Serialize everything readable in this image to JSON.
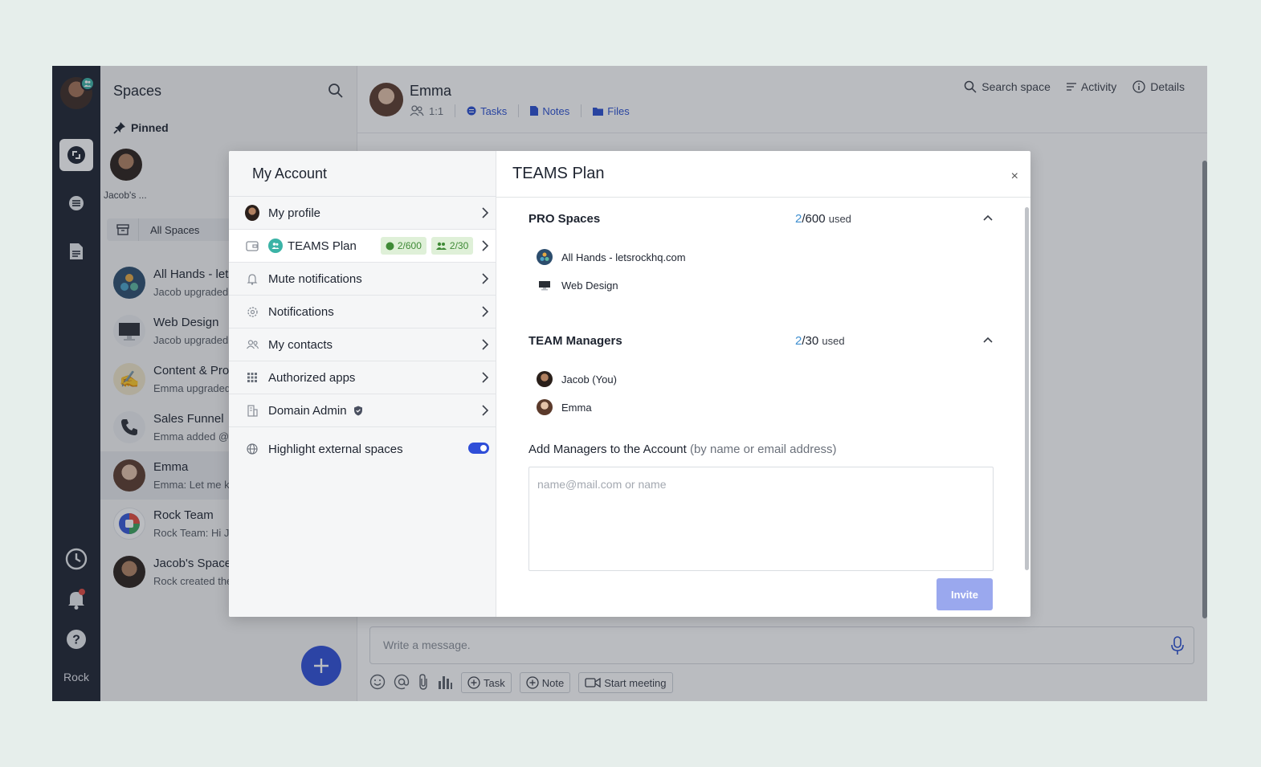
{
  "rail": {
    "label": "Rock"
  },
  "spaces": {
    "title": "Spaces",
    "pinned_label": "Pinned",
    "pinned_item_name": "Jacob's ...",
    "filter_label": "All Spaces",
    "items": [
      {
        "name": "All Hands - lets",
        "subtitle": "Jacob upgraded"
      },
      {
        "name": "Web Design",
        "subtitle": "Jacob upgraded"
      },
      {
        "name": "Content & Proc",
        "subtitle": "Emma upgraded"
      },
      {
        "name": "Sales Funnel",
        "subtitle": "Emma added @r"
      },
      {
        "name": "Emma",
        "subtitle": "Emma: Let me k"
      },
      {
        "name": "Rock Team",
        "subtitle": "Rock Team: Hi J"
      },
      {
        "name": "Jacob's Space",
        "subtitle": "Rock created the"
      }
    ]
  },
  "chat": {
    "title": "Emma",
    "type": "1:1",
    "links": {
      "tasks": "Tasks",
      "notes": "Notes",
      "files": "Files"
    },
    "actions": {
      "search": "Search space",
      "activity": "Activity",
      "details": "Details"
    },
    "composer_placeholder": "Write a message.",
    "tools": {
      "task": "Task",
      "note": "Note",
      "meeting": "Start meeting"
    }
  },
  "modal": {
    "left_title": "My Account",
    "menu": {
      "profile": "My profile",
      "teams_plan": "TEAMS Plan",
      "teams_badge_spaces": "2/600",
      "teams_badge_members": "2/30",
      "mute": "Mute notifications",
      "notifications": "Notifications",
      "contacts": "My contacts",
      "apps": "Authorized apps",
      "domain_admin": "Domain Admin",
      "highlight": "Highlight external spaces"
    },
    "highlight_enabled": true,
    "right_title": "TEAMS Plan",
    "close_symbol": "×",
    "pro_spaces": {
      "title": "PRO Spaces",
      "used": "2",
      "total": "/600",
      "used_label": "used",
      "items": [
        "All Hands - letsrockhq.com",
        "Web Design"
      ]
    },
    "team_managers": {
      "title": "TEAM Managers",
      "used": "2",
      "total": "/30",
      "used_label": "used",
      "items": [
        "Jacob (You)",
        "Emma"
      ]
    },
    "add_managers": {
      "label": "Add Managers to the Account",
      "hint": "(by name or email address)",
      "placeholder": "name@mail.com or name",
      "invite_label": "Invite"
    }
  },
  "colors": {
    "accent": "#2f4ed8",
    "rail_bg": "#1d2330",
    "badge_green": "#3f8a36",
    "invite_disabled": "#9aa8ee"
  }
}
